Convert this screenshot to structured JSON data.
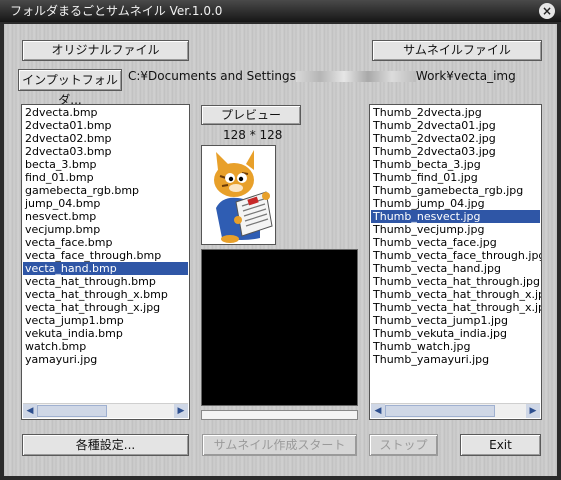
{
  "window": {
    "title": "フォルダまるごとサムネイル Ver.1.0.0",
    "close_glyph": "×"
  },
  "labels": {
    "original_files": "オリジナルファイル",
    "thumbnail_files": "サムネイルファイル"
  },
  "input_folder": {
    "button": "インプットフォルダ...",
    "path_prefix": "C:¥Documents and Settings",
    "path_suffix": "Work¥vecta_img"
  },
  "preview": {
    "label": "プレビュー",
    "size": "128 * 128"
  },
  "source_list": [
    "2dvecta.bmp",
    "2dvecta01.bmp",
    "2dvecta02.bmp",
    "2dvecta03.bmp",
    "becta_3.bmp",
    "find_01.bmp",
    "gamebecta_rgb.bmp",
    "jump_04.bmp",
    "nesvect.bmp",
    "vecjump.bmp",
    "vecta_face.bmp",
    "vecta_face_through.bmp",
    "vecta_hand.bmp",
    "vecta_hat_through.bmp",
    "vecta_hat_through_x.bmp",
    "vecta_hat_through_x.jpg",
    "vecta_jump1.bmp",
    "vekuta_india.bmp",
    "watch.bmp",
    "yamayuri.jpg"
  ],
  "source_selected": "vecta_hand.bmp",
  "thumb_list": [
    "Thumb_2dvecta.jpg",
    "Thumb_2dvecta01.jpg",
    "Thumb_2dvecta02.jpg",
    "Thumb_2dvecta03.jpg",
    "Thumb_becta_3.jpg",
    "Thumb_find_01.jpg",
    "Thumb_gamebecta_rgb.jpg",
    "Thumb_jump_04.jpg",
    "Thumb_nesvect.jpg",
    "Thumb_vecjump.jpg",
    "Thumb_vecta_face.jpg",
    "Thumb_vecta_face_through.jpg",
    "Thumb_vecta_hand.jpg",
    "Thumb_vecta_hat_through.jpg",
    "Thumb_vecta_hat_through_x.jpg",
    "Thumb_vecta_hat_through_x.jpg",
    "Thumb_vecta_jump1.jpg",
    "Thumb_vekuta_india.jpg",
    "Thumb_watch.jpg",
    "Thumb_yamayuri.jpg"
  ],
  "thumb_selected": "Thumb_nesvect.jpg",
  "buttons": {
    "settings": "各種設定...",
    "start": "サムネイル作成スタート",
    "stop": "ストップ",
    "exit": "Exit"
  },
  "colors": {
    "selection": "#2f56a6",
    "background_preview": "#000000"
  },
  "icons": {
    "scroll_left": "◀",
    "scroll_right": "▶"
  }
}
